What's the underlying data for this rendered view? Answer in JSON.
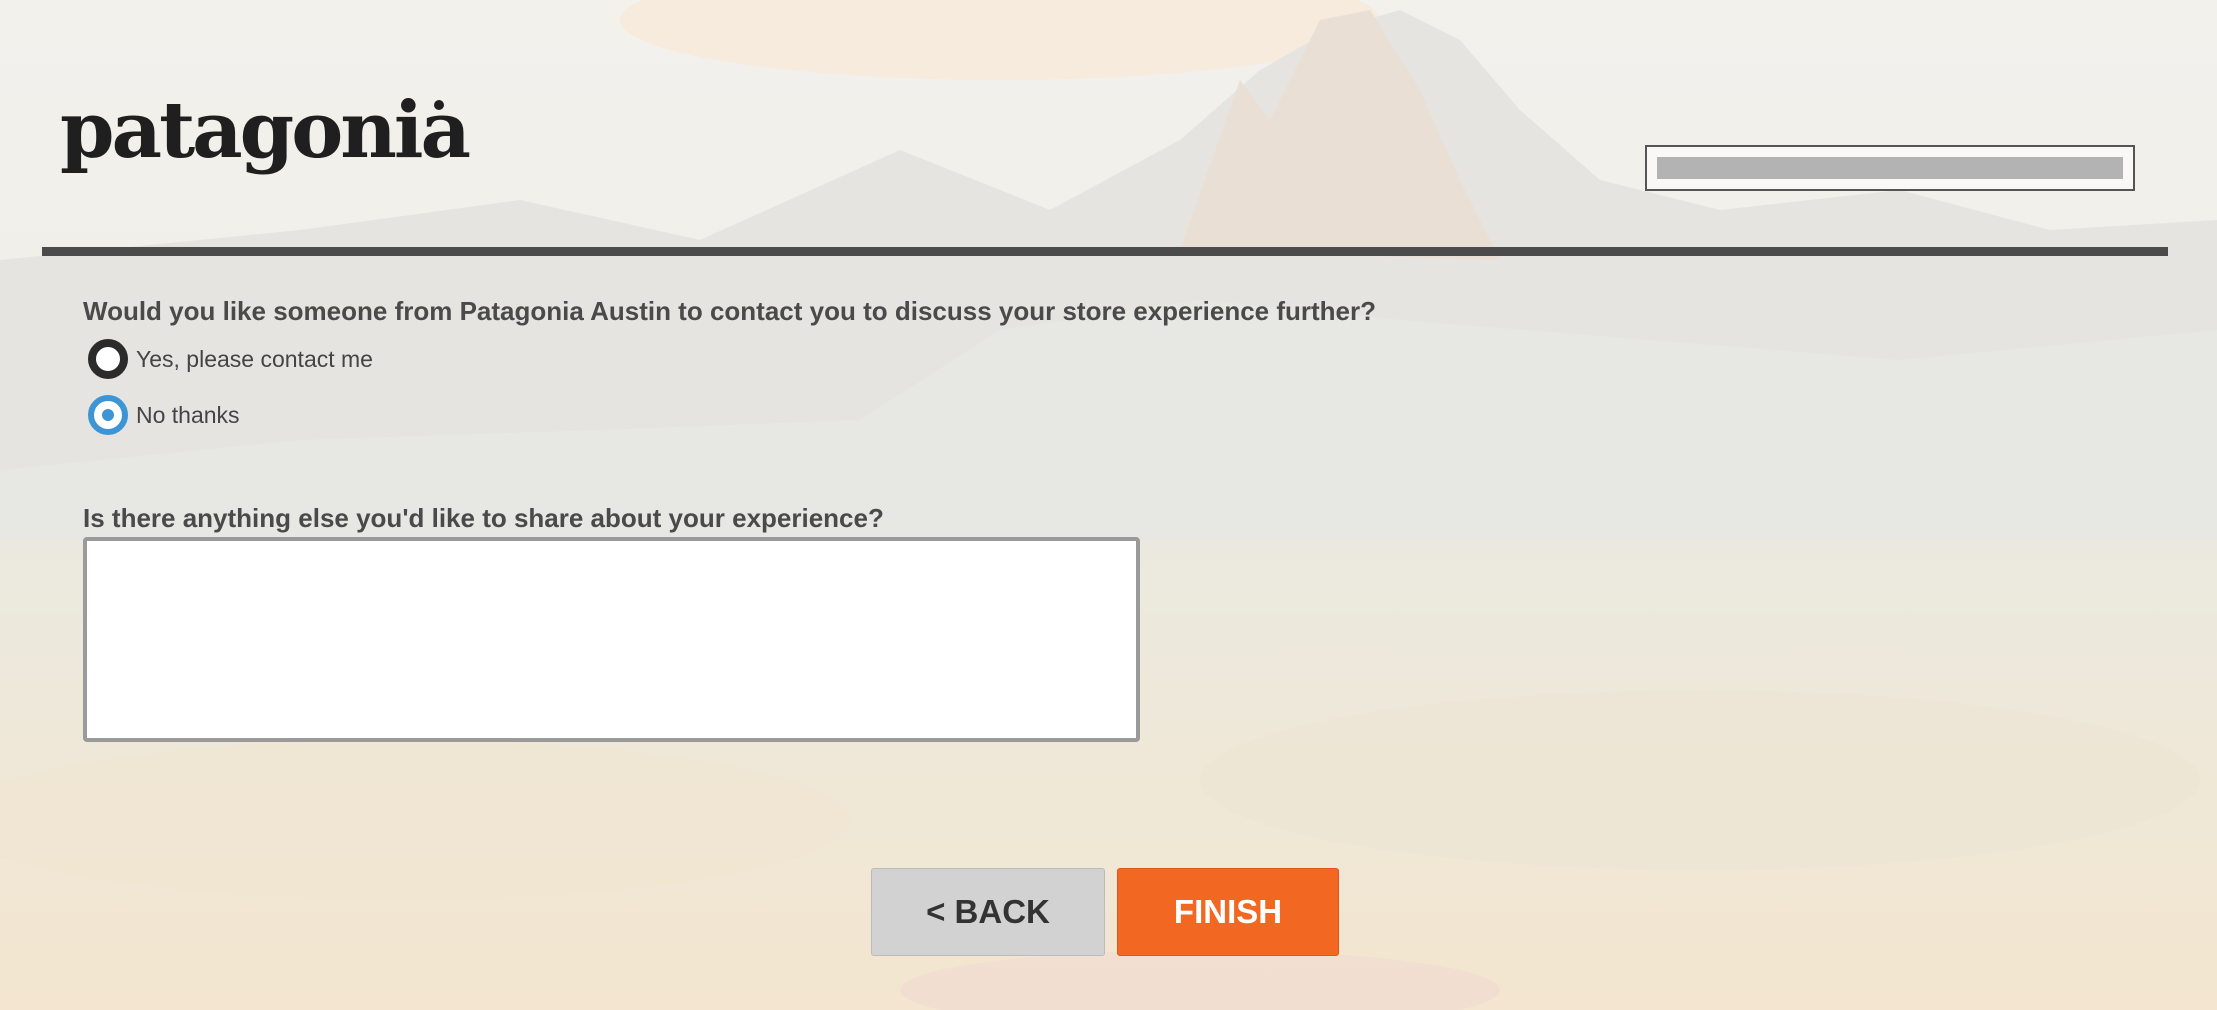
{
  "brand": {
    "logo_text": "patagonia"
  },
  "survey": {
    "contact_question": "Would you like someone from Patagonia Austin to contact you to discuss your store experience further?",
    "contact_options": [
      {
        "label": "Yes, please contact me",
        "selected": false
      },
      {
        "label": "No thanks",
        "selected": true
      }
    ],
    "share_question": "Is there anything else you'd like to share about your experience?",
    "share_value": ""
  },
  "nav": {
    "back_label": "< BACK",
    "finish_label": "FINISH"
  },
  "colors": {
    "accent": "#f26722",
    "radio_selected": "#3d95d6",
    "rule": "#4b4b4b",
    "back_button": "#d2d2d2"
  },
  "icons": {
    "logo": "patagonia-wordmark",
    "background": "mountain-landscape-image"
  }
}
